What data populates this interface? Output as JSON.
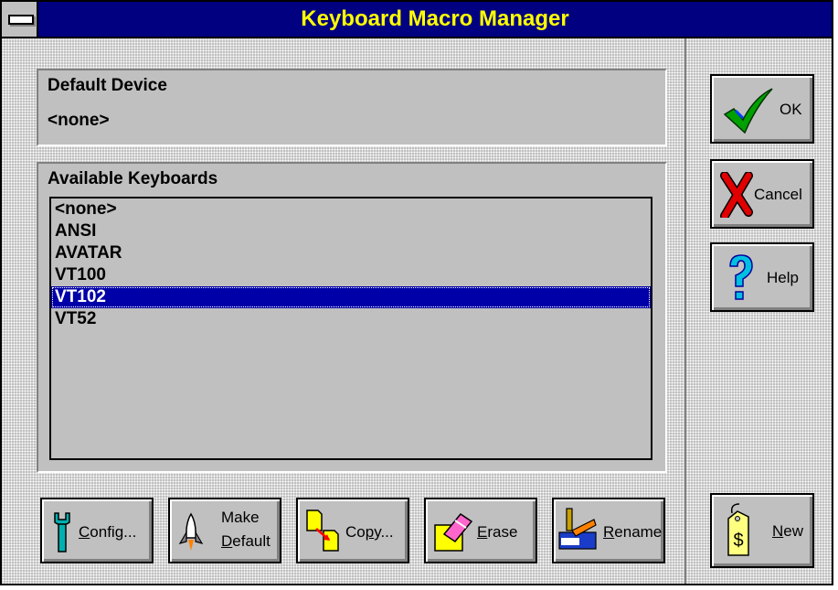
{
  "window": {
    "title": "Keyboard Macro Manager"
  },
  "default_device": {
    "label": "Default Device",
    "value": "<none>"
  },
  "available": {
    "label": "Available Keyboards",
    "items": [
      "<none>",
      "ANSI",
      "AVATAR",
      "VT100",
      "VT102",
      "VT52"
    ],
    "selected": "VT102"
  },
  "buttons": {
    "ok": "OK",
    "cancel": "Cancel",
    "help": "Help",
    "new_ul": "N",
    "new_rest": "ew",
    "config_ul": "C",
    "config_rest": "onfig...",
    "make_line1": "Make",
    "make_ul": "D",
    "make_rest": "efault",
    "copy_pre": "Co",
    "copy_ul": "p",
    "copy_rest": "y...",
    "erase_ul": "E",
    "erase_rest": "rase",
    "rename_ul": "R",
    "rename_rest": "ename"
  },
  "icons": {
    "ok": "checkmark-icon",
    "cancel": "red-x-icon",
    "help": "question-mark-icon",
    "new": "price-tag-icon",
    "config": "wrench-icon",
    "make_default": "rocket-icon",
    "copy": "copy-documents-icon",
    "erase": "eraser-icon",
    "rename": "rename-icon"
  },
  "colors": {
    "titlebar": "#000080",
    "title_text": "#ffff00",
    "selection": "#0000a8",
    "face": "#c0c0c0"
  }
}
